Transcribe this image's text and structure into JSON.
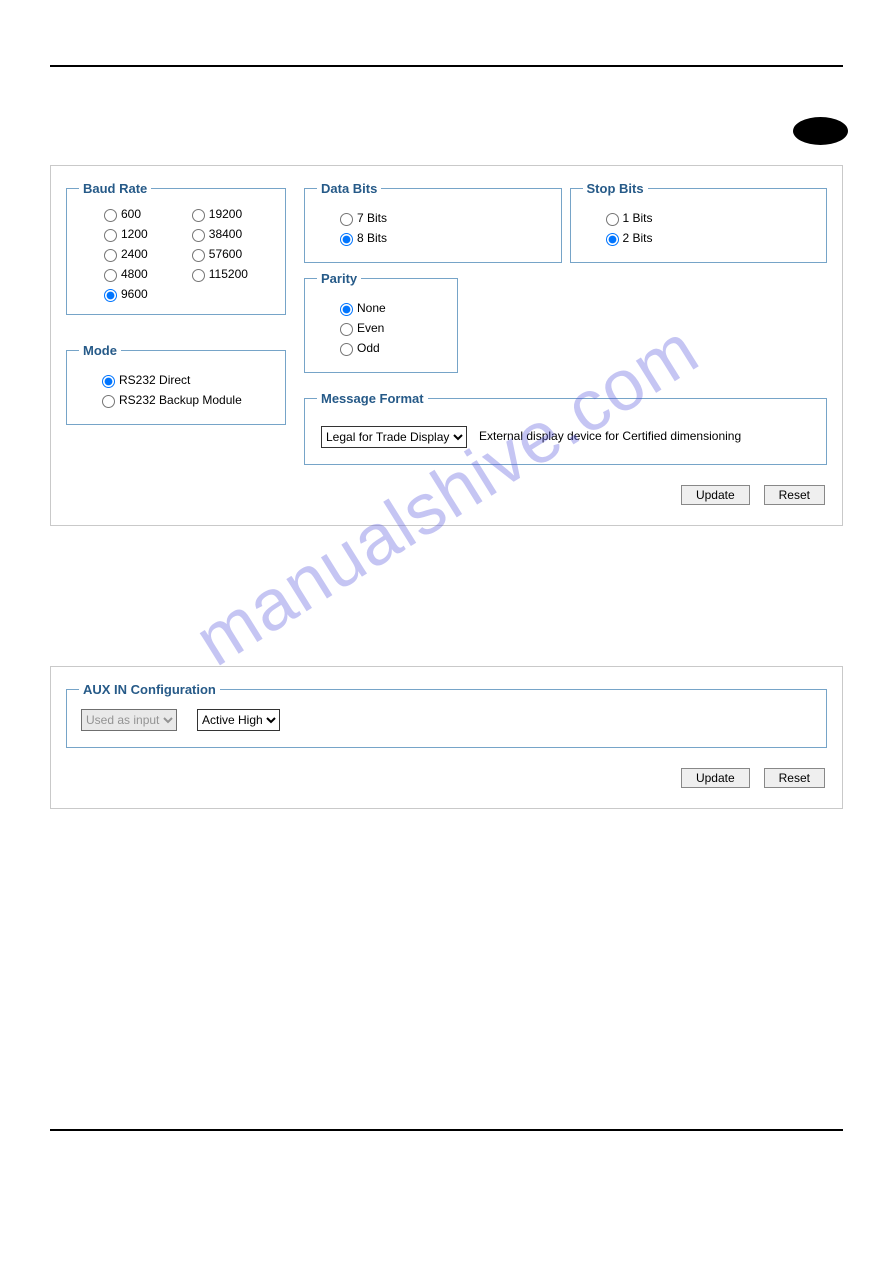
{
  "watermark": "manualshive.com",
  "panel1": {
    "baud": {
      "title": "Baud Rate",
      "options": [
        "600",
        "1200",
        "2400",
        "4800",
        "9600",
        "19200",
        "38400",
        "57600",
        "115200"
      ],
      "selected": "9600"
    },
    "databits": {
      "title": "Data Bits",
      "options": [
        "7 Bits",
        "8 Bits"
      ],
      "selected": "8 Bits"
    },
    "stopbits": {
      "title": "Stop Bits",
      "options": [
        "1 Bits",
        "2 Bits"
      ],
      "selected": "2 Bits"
    },
    "parity": {
      "title": "Parity",
      "options": [
        "None",
        "Even",
        "Odd"
      ],
      "selected": "None"
    },
    "mode": {
      "title": "Mode",
      "options": [
        "RS232 Direct",
        "RS232 Backup Module"
      ],
      "selected": "RS232 Direct"
    },
    "msgformat": {
      "title": "Message Format",
      "select": "Legal for Trade Display",
      "desc": "External display device for Certified dimensioning"
    },
    "buttons": {
      "update": "Update",
      "reset": "Reset"
    }
  },
  "panel2": {
    "aux": {
      "title": "AUX IN Configuration",
      "mode_select": "Used as input",
      "active_select": "Active High"
    },
    "buttons": {
      "update": "Update",
      "reset": "Reset"
    }
  }
}
